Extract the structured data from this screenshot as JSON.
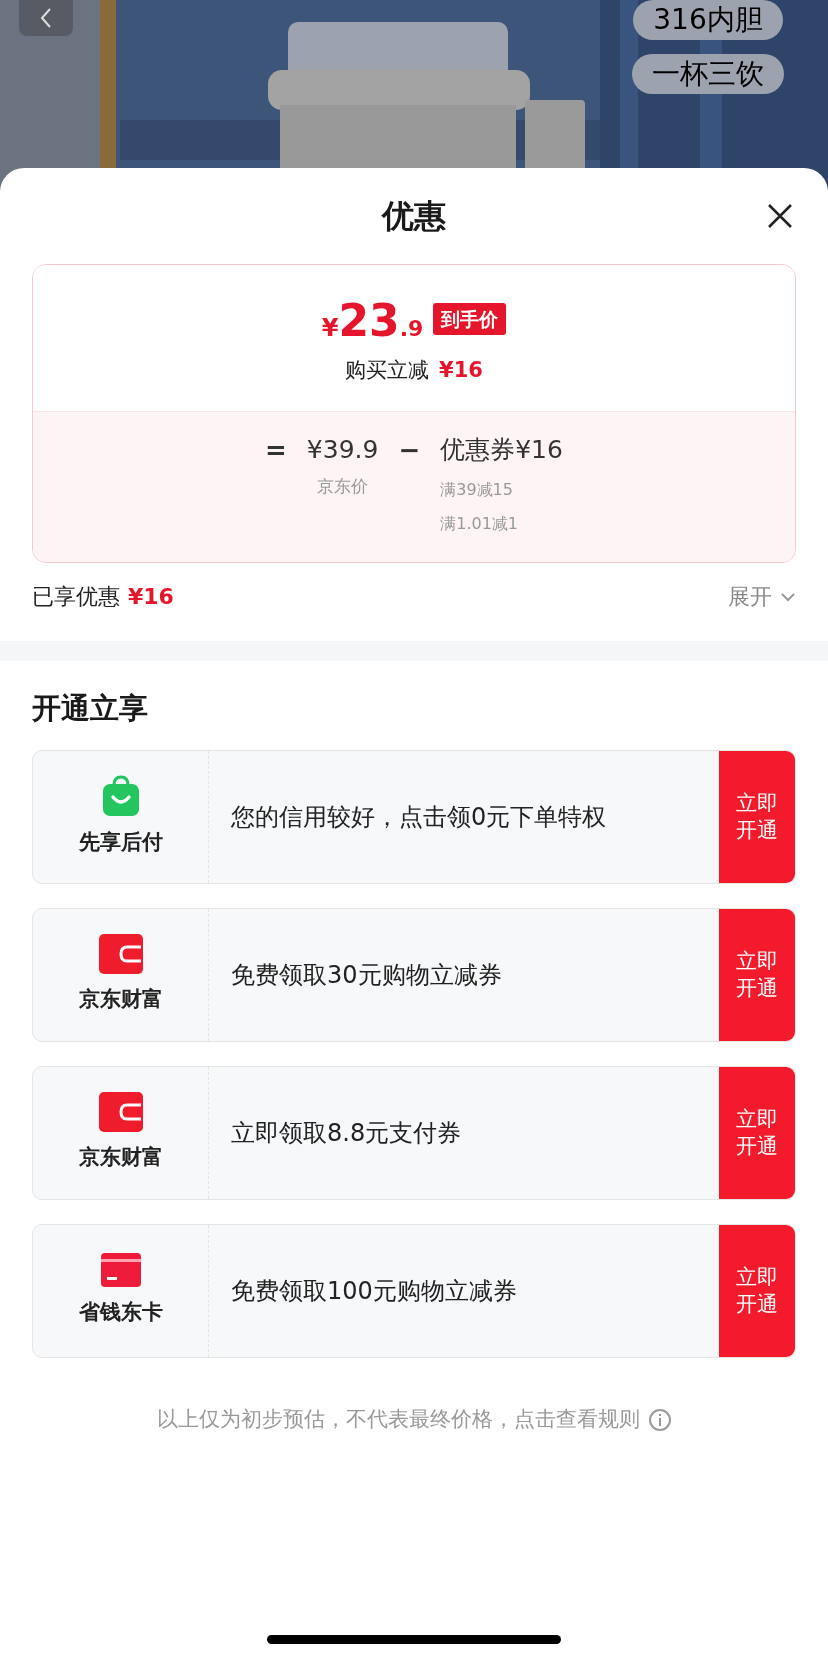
{
  "header": {
    "tags": [
      "316内胆",
      "一杯三饮"
    ]
  },
  "sheet": {
    "title": "优惠",
    "price": {
      "currency": "¥",
      "integer": "23",
      "decimal": ".9",
      "badge": "到手价",
      "saving_label": "购买立减",
      "saving_value": "¥16"
    },
    "breakdown": {
      "equals": "=",
      "base_price": "¥39.9",
      "base_label": "京东价",
      "minus": "−",
      "coupon": "优惠券¥16",
      "coupon_rules": [
        "满39减15",
        "满1.01减1"
      ]
    },
    "enjoyed": {
      "label": "已享优惠",
      "value": "¥16",
      "expand": "展开"
    },
    "section_title": "开通立享",
    "offers": [
      {
        "kind": "bag",
        "name": "先享后付",
        "text": "您的信用较好，点击领0元下单特权",
        "action": "立即开通"
      },
      {
        "kind": "wallet",
        "name": "京东财富",
        "text": "免费领取30元购物立减券",
        "action": "立即开通"
      },
      {
        "kind": "wallet",
        "name": "京东财富",
        "text": "立即领取8.8元支付券",
        "action": "立即开通"
      },
      {
        "kind": "card",
        "name": "省钱东卡",
        "text": "免费领取100元购物立减券",
        "action": "立即开通"
      }
    ],
    "footer": "以上仅为初步预估，不代表最终价格，点击查看规则"
  }
}
